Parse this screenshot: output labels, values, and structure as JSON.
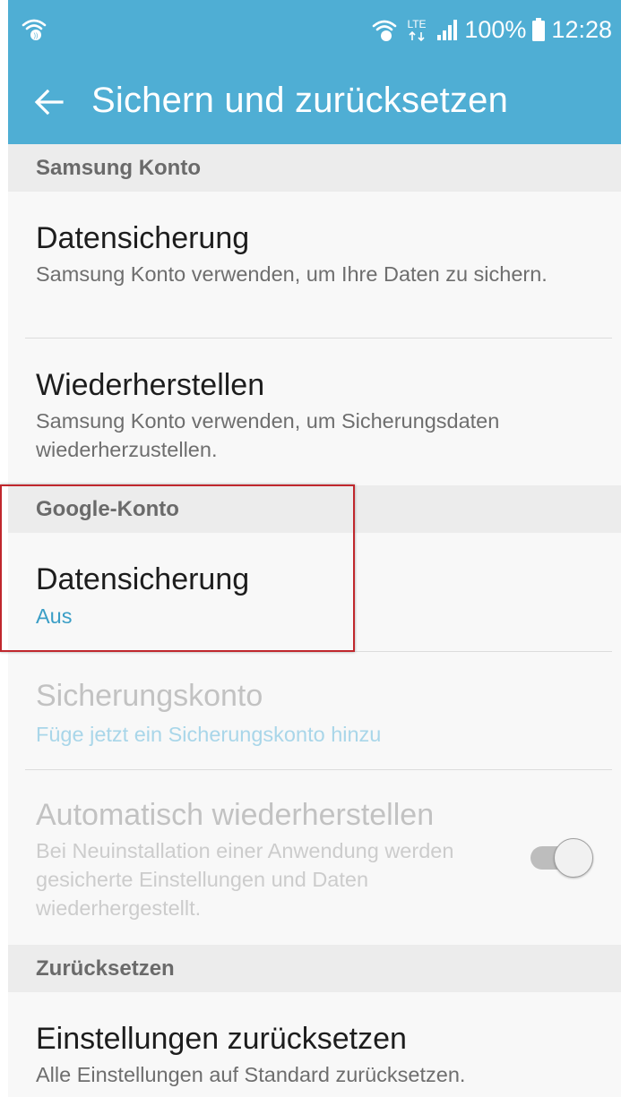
{
  "status_bar": {
    "battery": "100%",
    "time": "12:28",
    "network": "LTE",
    "icons": [
      "wifi-calling-icon",
      "wifi-calling-icon",
      "signal-icon",
      "battery-icon"
    ]
  },
  "app_bar": {
    "title": "Sichern und zurücksetzen",
    "back_icon": "arrow-left-icon"
  },
  "sections": {
    "samsung": {
      "header": "Samsung Konto",
      "backup_title": "Datensicherung",
      "backup_sub": "Samsung Konto verwenden, um Ihre Daten zu sichern.",
      "restore_title": "Wiederherstellen",
      "restore_sub": "Samsung Konto verwenden, um Sicherungsdaten wiederherzustellen."
    },
    "google": {
      "header": "Google-Konto",
      "backup_title": "Datensicherung",
      "backup_value": "Aus",
      "account_title": "Sicherungskonto",
      "account_sub": "Füge jetzt ein Sicherungskonto hinzu",
      "auto_restore_title": "Automatisch wiederherstellen",
      "auto_restore_sub": "Bei Neuinstallation einer Anwendung werden gesicherte Einstellungen und Daten wiederhergestellt.",
      "auto_restore_enabled": true
    },
    "reset": {
      "header": "Zurücksetzen",
      "settings_title": "Einstellungen zurücksetzen",
      "settings_sub": "Alle Einstellungen auf Standard zurücksetzen."
    }
  },
  "colors": {
    "accent": "#4faed4",
    "accent_text": "#3a9ec6",
    "highlight": "#c0272d"
  }
}
